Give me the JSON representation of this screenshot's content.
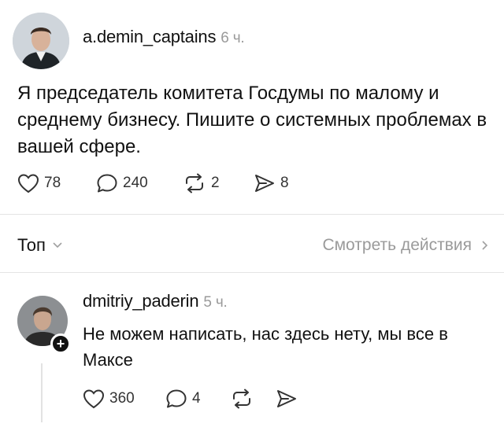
{
  "post": {
    "username": "a.demin_captains",
    "time": "6 ч.",
    "text": "Я председатель комитета Госдумы по малому и среднему бизнесу. Пишите о системных проблемах в вашей сфере.",
    "likes": "78",
    "comments": "240",
    "reposts": "2",
    "shares": "8"
  },
  "sort": {
    "label": "Топ",
    "view_activity": "Смотреть действия"
  },
  "reply": {
    "username": "dmitriy_paderin",
    "time": "5 ч.",
    "text": "Не можем написать, нас здесь нету, мы все в Максе",
    "likes": "360",
    "comments": "4",
    "follow_badge": "+"
  },
  "icons": {
    "like": "heart-icon",
    "comment": "comment-bubble-icon",
    "repost": "repost-icon",
    "share": "send-icon",
    "sort_toggle": "chevron-down-icon",
    "view_more": "chevron-right-icon"
  },
  "colors": {
    "text": "#111111",
    "muted": "#9a9a9a",
    "divider": "#e4e4e4"
  }
}
